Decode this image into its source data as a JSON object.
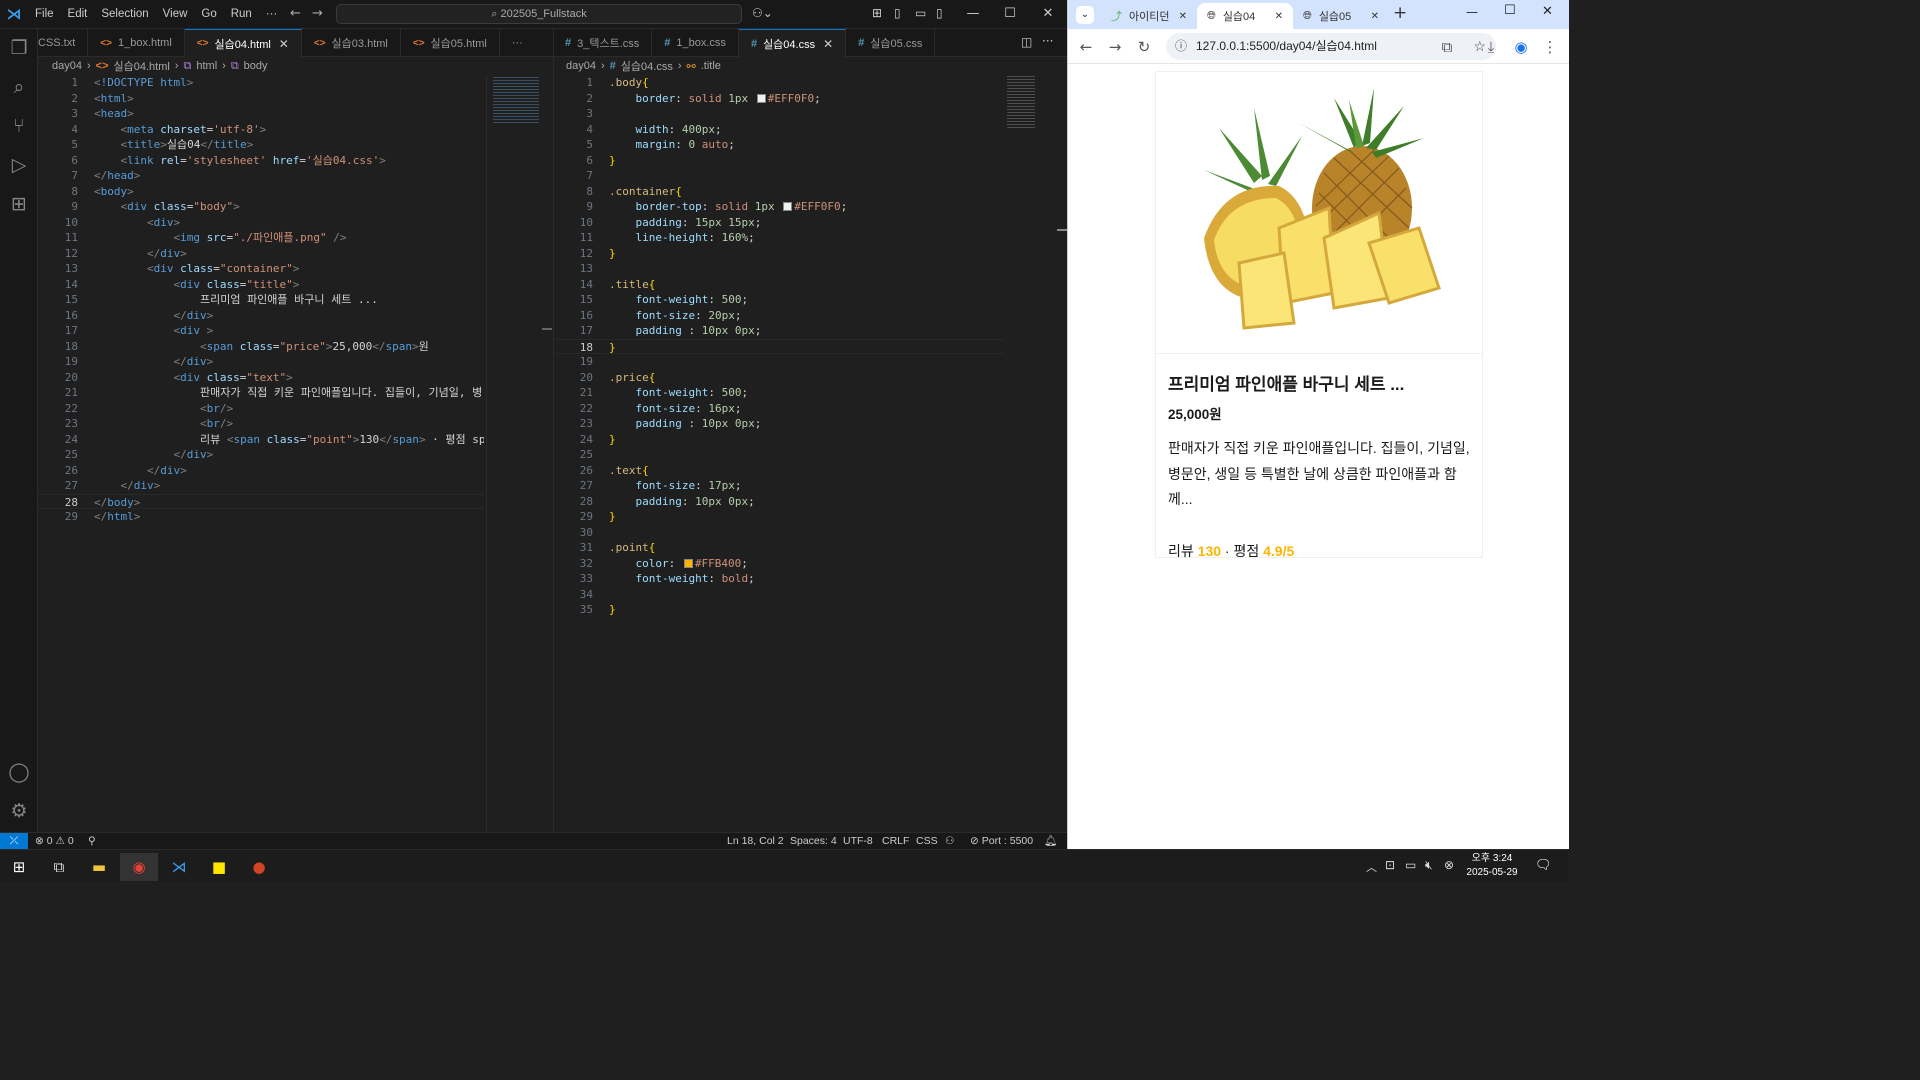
{
  "vscode": {
    "menu": [
      "File",
      "Edit",
      "Selection",
      "View",
      "Go",
      "Run",
      "···"
    ],
    "search": "202505_Fullstack",
    "left_tabs": [
      {
        "label": "CSS.txt",
        "icon": ""
      },
      {
        "label": "1_box.html",
        "icon": "<>"
      },
      {
        "label": "실습04.html",
        "icon": "<>",
        "active": true,
        "close": "✕"
      },
      {
        "label": "실습03.html",
        "icon": "<>"
      },
      {
        "label": "실습05.html",
        "icon": "<>"
      }
    ],
    "right_tabs": [
      {
        "label": "3_텍스트.css",
        "icon": "#"
      },
      {
        "label": "1_box.css",
        "icon": "#"
      },
      {
        "label": "실습04.css",
        "icon": "#",
        "active": true,
        "close": "✕"
      },
      {
        "label": "실습05.css",
        "icon": "#"
      }
    ],
    "more": "···",
    "left_breadcrumb": [
      "day04",
      "실습04.html",
      "html",
      "body"
    ],
    "right_breadcrumb": [
      "day04",
      "실습04.css",
      ".title"
    ],
    "html_lines": [
      "<!DOCTYPE html>",
      "<html>",
      "<head>",
      "    <meta charset='utf-8'>",
      "    <title>실습04</title>",
      "    <link rel='stylesheet' href='실습04.css'>",
      "</head>",
      "<body>",
      "    <div class=\"body\">",
      "        <div>",
      "            <img src=\"./파인애플.png\" />",
      "        </div>",
      "        <div class=\"container\">",
      "            <div class=\"title\">",
      "                프리미엄 파인애플 바구니 세트 ...",
      "            </div>",
      "            <div >",
      "                <span class=\"price\">25,000</span>원",
      "            </div>",
      "            <div class=\"text\">",
      "                판매자가 직접 키운 파인애플입니다. 집들이, 기념일, 병",
      "                <br/>",
      "                <br/>",
      "                리뷰 <span class=\"point\">130</span> · 평점 <spa",
      "            </div>",
      "        </div>",
      "    </div>",
      "</body>",
      "</html>"
    ],
    "css_lines": [
      ".body{",
      "    border: solid 1px ▢#EFF0F0;",
      "",
      "    width: 400px;",
      "    margin: 0 auto;",
      "}",
      "",
      ".container{",
      "    border-top: solid 1px ▢#EFF0F0;",
      "    padding: 15px 15px;",
      "    line-height: 160%;",
      "}",
      "",
      ".title{",
      "    font-weight: 500;",
      "    font-size: 20px;",
      "    padding : 10px 0px;",
      "}",
      "",
      ".price{",
      "    font-weight: 500;",
      "    font-size: 16px;",
      "    padding : 10px 0px;",
      "}",
      "",
      ".text{",
      "    font-size: 17px;",
      "    padding: 10px 0px;",
      "}",
      "",
      ".point{",
      "    color: ▢#FFB400;",
      "    font-weight: bold;",
      "",
      "}"
    ],
    "html_current_line": 28,
    "css_current_line": 18,
    "status": {
      "errors": "0",
      "warnings": "0",
      "position": "Ln 18, Col 2",
      "spaces": "Spaces: 4",
      "encoding": "UTF-8",
      "eol": "CRLF",
      "language": "CSS",
      "port": "Port : 5500"
    },
    "colors": {
      "accent": "#0078d4",
      "swatch_gray": "#EFF0F0",
      "swatch_orange": "#FFB400"
    }
  },
  "chrome": {
    "tabs": [
      {
        "label": "아이티던",
        "close": "✕"
      },
      {
        "label": "실습04",
        "close": "✕",
        "active": true
      },
      {
        "label": "실습05",
        "close": "✕"
      }
    ],
    "new_tab": "+",
    "url": "127.0.0.1:5500/day04/실습04.html",
    "product": {
      "title": "프리미엄 파인애플 바구니 세트 ...",
      "price": "25,000",
      "price_unit": "원",
      "text": "판매자가 직접 키운 파인애플입니다. 집들이, 기념일, 병문안, 생일 등 특별한 날에 상큼한 파인애플과 함께...",
      "review_label": "리뷰",
      "review_count": "130",
      "separator": "·",
      "rating_label": "평점",
      "rating": "4.9/5"
    }
  },
  "taskbar": {
    "time": "오후 3:24",
    "date": "2025-05-29"
  }
}
